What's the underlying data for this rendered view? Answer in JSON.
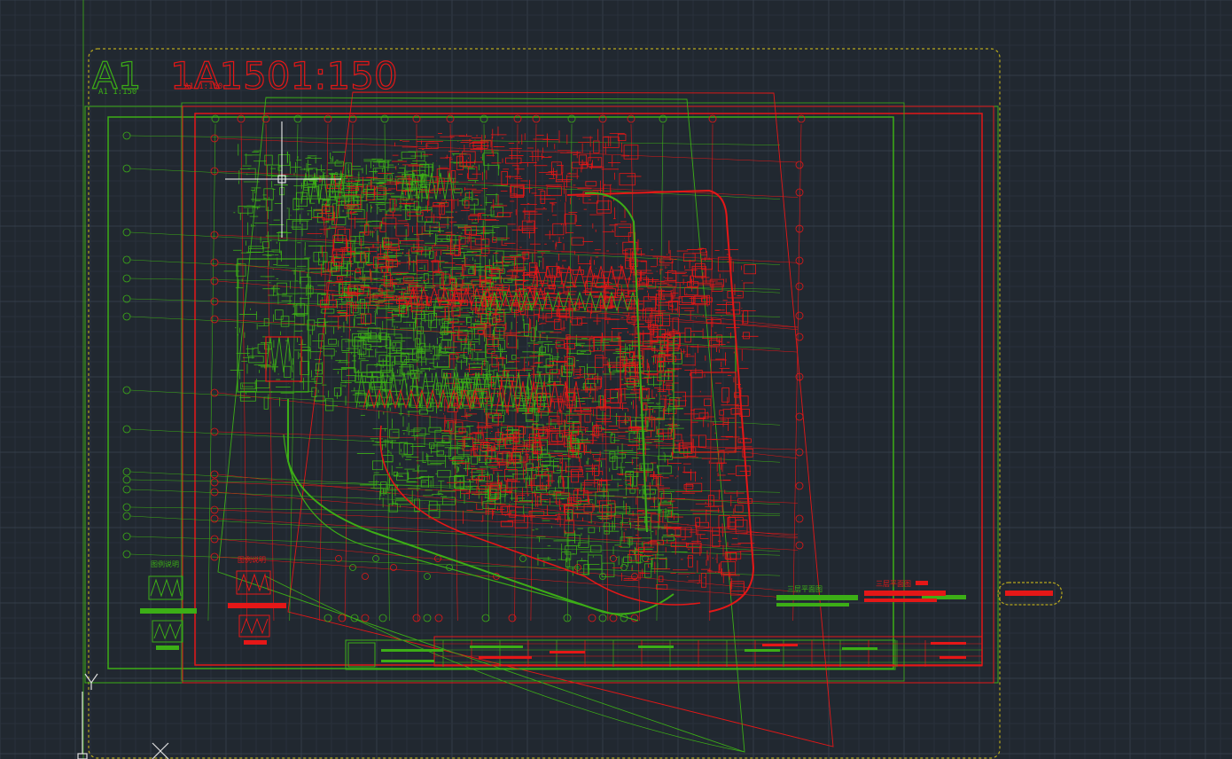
{
  "app": {
    "name": "CAD model space viewport"
  },
  "colors": {
    "background": "#212830",
    "grid_minor": "#2a323c",
    "grid_major": "#323b47",
    "layer_green": "#3cae16",
    "layer_red": "#e51717",
    "layer_yellow": "#b8a81c",
    "layer_white": "#ffffff",
    "crosshair": "#ffffff",
    "ucs_icon": "#e0e0e0"
  },
  "labels": {
    "sheet_big_1": "A1",
    "sheet_big_2": "1A1501:150",
    "sheet_small_1": "A1  1:150",
    "sheet_small_2": "A1  1:150",
    "legend_green_title": "图例说明",
    "legend_red_title": "图例说明",
    "plan_green_title": "三层平面图",
    "plan_red_title": "三层平面图"
  },
  "icons": {
    "ucs": "ucs-axis-icon",
    "cursor": "crosshair-cursor-icon",
    "revcloud": "revision-cloud-icon"
  }
}
